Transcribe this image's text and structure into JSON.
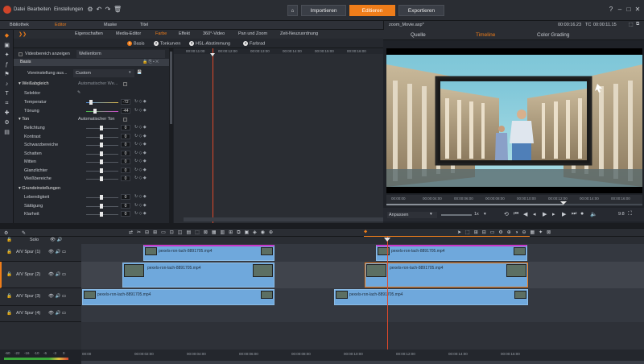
{
  "menu": {
    "items": [
      "Datei",
      "Bearbeiten",
      "Einstellungen"
    ],
    "modes": [
      "Importieren",
      "Editieren",
      "Exportieren"
    ]
  },
  "panel_tabs": [
    {
      "label": "Bibliothek",
      "active": false
    },
    {
      "label": "Editor",
      "active": true
    },
    {
      "label": "Maske",
      "active": false
    },
    {
      "label": "Titel",
      "active": false
    }
  ],
  "editor_tabs": [
    {
      "label": "Eigenschaften",
      "active": false
    },
    {
      "label": "Media-Editor",
      "active": false
    },
    {
      "label": "Farbe",
      "active": true
    },
    {
      "label": "Effekt",
      "active": false
    },
    {
      "label": "360°-Video",
      "active": false
    },
    {
      "label": "Pan und Zoom",
      "active": false
    },
    {
      "label": "Zeit-Neuzuordnung",
      "active": false
    }
  ],
  "color_subtabs": [
    {
      "num": "1",
      "label": "Basis",
      "active": true
    },
    {
      "num": "2",
      "label": "Tonkurven",
      "active": false
    },
    {
      "num": "3",
      "label": "HSL-Abstimmung",
      "active": false
    },
    {
      "num": "4",
      "label": "Farbrad",
      "active": false
    }
  ],
  "settings": {
    "show_video_area": "Videobereich anzeigen",
    "display_mode": "Wellenform",
    "section_basis": "Basis",
    "preset_label": "Voreinstellung aus...",
    "preset_value": "Custom",
    "white_balance": "Weißabgleich",
    "auto_white": "Automatischer We...",
    "selector": "Selektor",
    "temperature": {
      "label": "Temperatur",
      "value": "-72",
      "fraction": 0.15
    },
    "tint": {
      "label": "Tönung",
      "value": "-44",
      "fraction": 0.28
    },
    "tone": "Ton",
    "auto_tone": "Automatischer Ton",
    "tone_rows": [
      {
        "label": "Belichtung",
        "value": "0"
      },
      {
        "label": "Kontrast",
        "value": "0"
      },
      {
        "label": "Schwarzbereiche",
        "value": "0"
      },
      {
        "label": "Schatten",
        "value": "0"
      },
      {
        "label": "Mitten",
        "value": "0"
      },
      {
        "label": "Glanzlichter",
        "value": "0"
      },
      {
        "label": "Weißbereiche",
        "value": "0"
      }
    ],
    "basic_settings": "Grundeinstellungen",
    "basic_rows": [
      {
        "label": "Lebendigkeit",
        "value": "0"
      },
      {
        "label": "Sättigung",
        "value": "0"
      },
      {
        "label": "Klarheit",
        "value": "0"
      }
    ]
  },
  "keyframe_ticks": [
    "00:00:11:00",
    "00:00:12:00",
    "00:00:13:00",
    "00:00:14:00",
    "00:00:15:00",
    "00:00:16:00"
  ],
  "preview": {
    "file_title": "zoom_Movie.axp*",
    "timecode_label": "TC",
    "timecode_left": "00:00:16.23",
    "timecode_right": "00:00:11.15",
    "tabs": [
      {
        "label": "Quelle",
        "active": false
      },
      {
        "label": "Timeline",
        "active": true
      },
      {
        "label": "Color Grading",
        "active": false
      }
    ],
    "fit": "Anpassen",
    "speed": "1x",
    "ratio": "9:8",
    "ruler_ticks": [
      "00:00:00",
      "00:00:04:00",
      "00:00:06:00",
      "00:00:08:00",
      "00:00:10:00",
      "00:00:12:00",
      "00:00:14:00",
      "00:00:16:00"
    ]
  },
  "timeline": {
    "solo": "Solo",
    "tracks": [
      {
        "label": "A/V Spur (1)"
      },
      {
        "label": "A/V Spur (2)"
      },
      {
        "label": "A/V Spur (3)"
      },
      {
        "label": "A/V Spur (4)"
      }
    ],
    "clip_name": "pexels-ron-lach-8891705.mp4",
    "ruler_ticks": [
      "00:00",
      "00:00:02:00",
      "00:00:04:00",
      "00:00:06:00",
      "00:00:08:00",
      "00:00:10:00",
      "00:00:12:00",
      "00:00:14:00",
      "00:00:16:00"
    ],
    "vu_labels": [
      "-60",
      "-22",
      "-16",
      "-10",
      "-6",
      "-3",
      "0"
    ]
  },
  "colors": {
    "accent": "#ef7d1a",
    "clip": "#6fa8dc",
    "playhead": "#e0482a",
    "selected": "#c837c8"
  }
}
